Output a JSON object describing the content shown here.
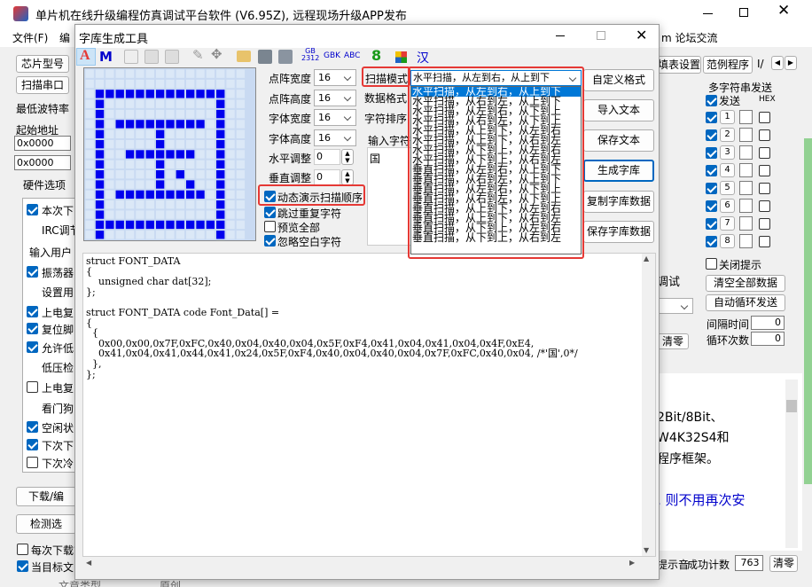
{
  "main_title": "单片机在线升级编程仿真调试平台软件 (V6.95Z), 远程现场升级APP发布",
  "menu": {
    "file": "文件(F)",
    "edit": "编",
    "forum": "m 论坛交流"
  },
  "right_tabs": {
    "tab1": "填表设置",
    "tab2": "范例程序",
    "tab3": "I/"
  },
  "multi_send": {
    "title": "多字符串发送",
    "col_send": "发送",
    "col_hex": "HEX",
    "rows": [
      "1",
      "2",
      "3",
      "4",
      "5",
      "6",
      "7",
      "8"
    ],
    "close_hint": "关闭提示",
    "clear_all": "清空全部数据",
    "auto_loop": "自动循环发送",
    "interval_label": "间隔时间",
    "interval_value": "0",
    "loop_label": "循环次数",
    "loop_value": "0"
  },
  "mid_right": {
    "debug_tail": "调试",
    "clear": "清零",
    "text1": "2Bit/8Bit、",
    "text2": "W4K32S4和",
    "text3": "程序框架。",
    "text4": ", 则不用再次安"
  },
  "bottom_right": {
    "beep_tail": "提示音",
    "success_label": "成功计数",
    "success_value": "763",
    "clear": "清零"
  },
  "left_panel": {
    "chip_btn": "芯片型号",
    "serial_btn": "扫描串口",
    "baud_label": "最低波特率",
    "start_addr": "起始地址",
    "addr1": "0x0000",
    "addr2": "0x0000",
    "hw_tab": "硬件选项",
    "opts": [
      "本次下",
      "IRC调节",
      "输入用户",
      "振荡器",
      "设置用",
      "上电复",
      "复位脚",
      "允许低",
      "低压检",
      "上电复",
      "看门狗",
      "空闲状",
      "下次下",
      "下次冷"
    ],
    "download_btn": "下载/编",
    "check_btn": "检测选",
    "each_dl": "每次下载前",
    "curr_target": "当目标文",
    "bottom_text": "文章类型",
    "bottom_text2": "原创"
  },
  "dialog": {
    "title": "字库生成工具",
    "toolbar": {
      "A": "A",
      "M": "M",
      "gb": "GB",
      "gb2": "2312",
      "gbk": "GBK",
      "abc": "ABC",
      "eight": "8",
      "han": "汉"
    },
    "width_label": "点阵宽度",
    "width_value": "16",
    "height_label": "点阵高度",
    "height_value": "16",
    "fw_label": "字体宽度",
    "fw_value": "16",
    "fh_label": "字体高度",
    "fh_value": "16",
    "hadj_label": "水平调整",
    "hadj_value": "0",
    "vadj_label": "垂直调整",
    "vadj_value": "0",
    "scan_mode_label": "扫描模式",
    "scan_mode_value": "水平扫描，从左到右，从上到下",
    "data_format_label": "数据格式",
    "char_order_label": "字符排序",
    "input_label": "输入字符",
    "input_value": "国",
    "scan_options": [
      "水平扫描，从左到右，从上到下",
      "水平扫描，从右到左，从上到下",
      "水平扫描，从左到右，从下到上",
      "水平扫描，从右到左，从下到上",
      "水平扫描，从上到下，从左到右",
      "水平扫描，从上到下，从右到左",
      "水平扫描，从下到上，从左到右",
      "水平扫描，从下到上，从右到左",
      "垂直扫描，从左到右，从上到下",
      "垂直扫描，从右到左，从上到下",
      "垂直扫描，从左到右，从下到上",
      "垂直扫描，从右到左，从下到上",
      "垂直扫描，从上到下，从左到右",
      "垂直扫描，从上到下，从右到左",
      "垂直扫描，从下到上，从左到右",
      "垂直扫描，从下到上，从右到左"
    ],
    "opt_demo": "动态演示扫描顺序",
    "opt_skip": "跳过重复字符",
    "opt_preview": "预览全部",
    "opt_ignore": "忽略空白字符",
    "btn_custom": "自定义格式",
    "btn_import": "导入文本",
    "btn_save_text": "保存文本",
    "btn_generate": "生成字库",
    "btn_copy": "复制字库数据",
    "btn_save_data": "保存字库数据",
    "code_lines": [
      "struct FONT_DATA",
      "{",
      "    unsigned char dat[32];",
      "};",
      "",
      "struct FONT_DATA code Font_Data[] =",
      "{",
      "  {",
      "    0x00,0x00,0x7F,0xFC,0x40,0x04,0x40,0x04,0x5F,0xF4,0x41,0x04,0x41,0x04,0x4F,0xE4,",
      "    0x41,0x04,0x41,0x44,0x41,0x24,0x5F,0xF4,0x40,0x04,0x40,0x04,0x7F,0xFC,0x40,0x04, /*'国',0*/",
      "  },",
      "};"
    ],
    "bitmap": [
      "0000000000000000",
      "0000000000000000",
      "0111111111111100",
      "0100000000000100",
      "0100000000000100",
      "0101111111110100",
      "0100000100000100",
      "0100000100000100",
      "0100111111100100",
      "0100000100000100",
      "0100000101000100",
      "0100000100100100",
      "0101111111110100",
      "0100000000000100",
      "0100000000000100",
      "0111111111111100",
      "0100000000000100"
    ]
  },
  "colors": {
    "accent": "#0067c0",
    "highlight": "#0078d7",
    "red": "#e53935",
    "pixel_on": "#0000ee",
    "pixel_off": "#dbe8f7"
  }
}
